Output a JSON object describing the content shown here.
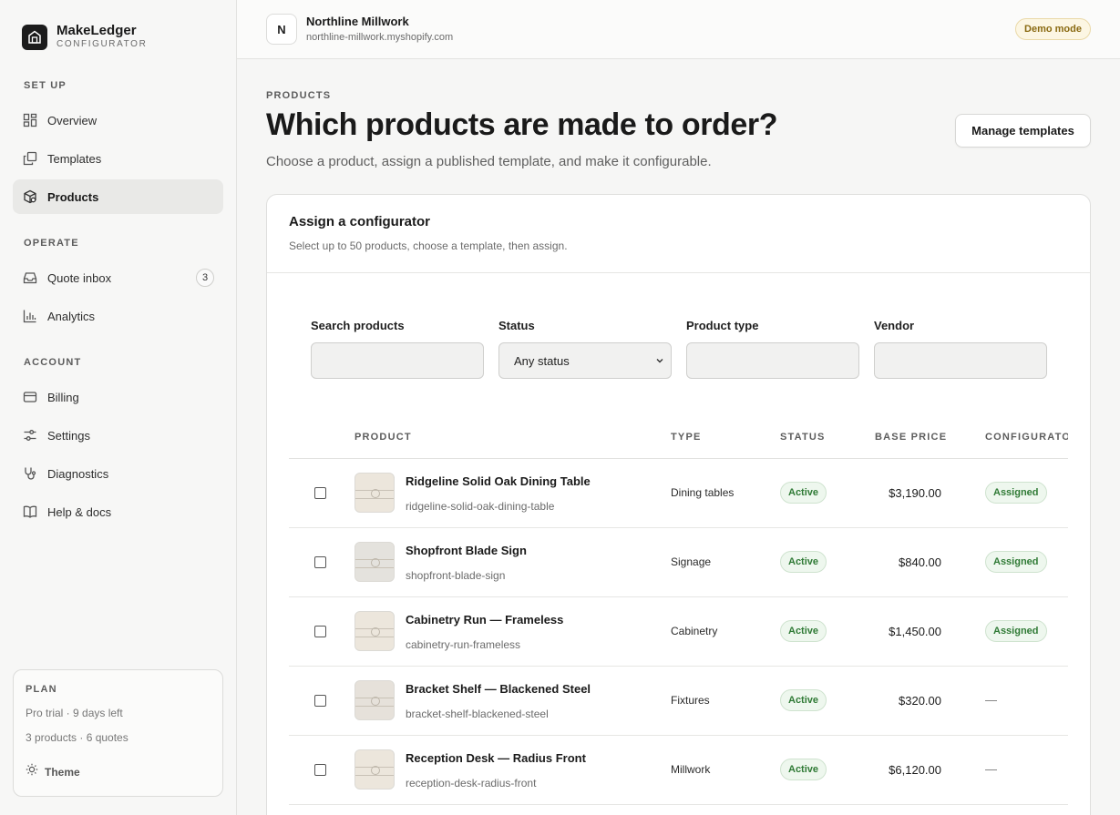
{
  "brand": {
    "name": "MakeLedger",
    "sub": "CONFIGURATOR"
  },
  "sidebar": {
    "sections": [
      {
        "label": "SET UP"
      },
      {
        "label": "OPERATE"
      },
      {
        "label": "ACCOUNT"
      }
    ],
    "items": [
      {
        "label": "Overview",
        "icon": "grid-icon"
      },
      {
        "label": "Templates",
        "icon": "copy-icon"
      },
      {
        "label": "Products",
        "icon": "package-icon",
        "active": true
      },
      {
        "label": "Quote inbox",
        "icon": "inbox-icon",
        "badge": "3"
      },
      {
        "label": "Analytics",
        "icon": "bar-chart-icon"
      },
      {
        "label": "Billing",
        "icon": "card-icon"
      },
      {
        "label": "Settings",
        "icon": "sliders-icon"
      },
      {
        "label": "Diagnostics",
        "icon": "stethoscope-icon"
      },
      {
        "label": "Help & docs",
        "icon": "book-icon"
      }
    ],
    "plan": {
      "title": "PLAN",
      "line1": "Pro trial · 9 days left",
      "line2": "3 products · 6 quotes",
      "theme_label": "Theme"
    }
  },
  "topbar": {
    "avatar": "N",
    "store_name": "Northline Millwork",
    "store_domain": "northline-millwork.myshopify.com",
    "demo_badge": "Demo mode"
  },
  "page": {
    "eyebrow": "PRODUCTS",
    "title": "Which products are made to order?",
    "subtitle": "Choose a product, assign a published template, and make it configurable.",
    "manage_button": "Manage templates"
  },
  "card": {
    "title": "Assign a configurator",
    "subtitle": "Select up to 50 products, choose a template, then assign.",
    "filters": {
      "search_label": "Search products",
      "search_value": "",
      "status_label": "Status",
      "status_value": "Any status",
      "type_label": "Product type",
      "type_value": "",
      "vendor_label": "Vendor",
      "vendor_value": ""
    },
    "table": {
      "headers": [
        "PRODUCT",
        "TYPE",
        "STATUS",
        "BASE PRICE",
        "CONFIGURATOR"
      ],
      "rows": [
        {
          "name": "Ridgeline Solid Oak Dining Table",
          "slug": "ridgeline-solid-oak-dining-table",
          "type": "Dining tables",
          "status": "Active",
          "price": "$3,190.00",
          "configurator": "Assigned"
        },
        {
          "name": "Shopfront Blade Sign",
          "slug": "shopfront-blade-sign",
          "type": "Signage",
          "status": "Active",
          "price": "$840.00",
          "configurator": "Assigned"
        },
        {
          "name": "Cabinetry Run — Frameless",
          "slug": "cabinetry-run-frameless",
          "type": "Cabinetry",
          "status": "Active",
          "price": "$1,450.00",
          "configurator": "Assigned"
        },
        {
          "name": "Bracket Shelf — Blackened Steel",
          "slug": "bracket-shelf-blackened-steel",
          "type": "Fixtures",
          "status": "Active",
          "price": "$320.00",
          "configurator": "—"
        },
        {
          "name": "Reception Desk — Radius Front",
          "slug": "reception-desk-radius-front",
          "type": "Millwork",
          "status": "Active",
          "price": "$6,120.00",
          "configurator": "—"
        }
      ]
    }
  },
  "colors": {
    "accent_green": "#2f7a35",
    "demo_amber": "#8a6a12",
    "text": "#1a1a1a"
  }
}
